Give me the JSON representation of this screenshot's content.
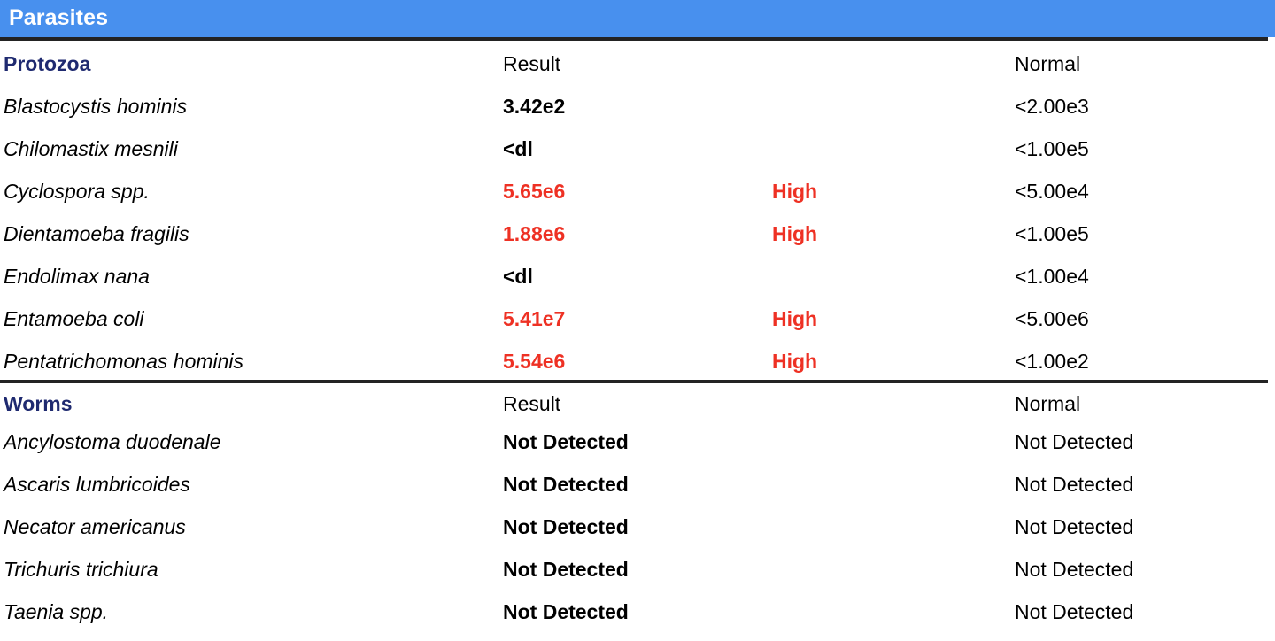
{
  "panel": {
    "title": "Parasites",
    "header_bg": "#4890ee",
    "header_text_color": "#ffffff",
    "abnormal_color": "#ee3124",
    "section_color": "#1f2a70"
  },
  "sections": [
    {
      "id": "protozoa",
      "heading": "Protozoa",
      "result_header": "Result",
      "normal_header": "Normal",
      "rows": [
        {
          "name": "Blastocystis hominis",
          "result": "3.42e2",
          "flag": "",
          "normal": "<2.00e3",
          "abnormal": false
        },
        {
          "name": "Chilomastix mesnili",
          "result": "<dl",
          "flag": "",
          "normal": "<1.00e5",
          "abnormal": false
        },
        {
          "name": "Cyclospora spp.",
          "result": "5.65e6",
          "flag": "High",
          "normal": "<5.00e4",
          "abnormal": true
        },
        {
          "name": "Dientamoeba fragilis",
          "result": "1.88e6",
          "flag": "High",
          "normal": "<1.00e5",
          "abnormal": true
        },
        {
          "name": "Endolimax nana",
          "result": "<dl",
          "flag": "",
          "normal": "<1.00e4",
          "abnormal": false
        },
        {
          "name": "Entamoeba coli",
          "result": "5.41e7",
          "flag": "High",
          "normal": "<5.00e6",
          "abnormal": true
        },
        {
          "name": "Pentatrichomonas hominis",
          "result": "5.54e6",
          "flag": "High",
          "normal": "<1.00e2",
          "abnormal": true
        }
      ]
    },
    {
      "id": "worms",
      "heading": "Worms",
      "result_header": "Result",
      "normal_header": "Normal",
      "rows": [
        {
          "name": "Ancylostoma duodenale",
          "result": "Not Detected",
          "flag": "",
          "normal": "Not Detected",
          "abnormal": false
        },
        {
          "name": "Ascaris lumbricoides",
          "result": "Not Detected",
          "flag": "",
          "normal": "Not Detected",
          "abnormal": false
        },
        {
          "name": "Necator americanus",
          "result": "Not Detected",
          "flag": "",
          "normal": "Not Detected",
          "abnormal": false
        },
        {
          "name": "Trichuris trichiura",
          "result": "Not Detected",
          "flag": "",
          "normal": "Not Detected",
          "abnormal": false
        },
        {
          "name": "Taenia spp.",
          "result": "Not Detected",
          "flag": "",
          "normal": "Not Detected",
          "abnormal": false
        }
      ]
    }
  ]
}
